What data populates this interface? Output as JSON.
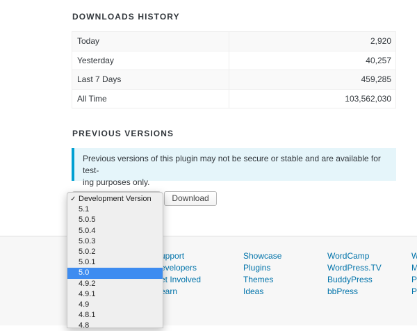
{
  "downloads": {
    "title": "DOWNLOADS HISTORY",
    "rows": [
      {
        "label": "Today",
        "value": "2,920"
      },
      {
        "label": "Yesterday",
        "value": "40,257"
      },
      {
        "label": "Last 7 Days",
        "value": "459,285"
      },
      {
        "label": "All Time",
        "value": "103,562,030"
      }
    ]
  },
  "previous_versions": {
    "title": "PREVIOUS VERSIONS",
    "notice_line1": "Previous versions of this plugin may not be secure or stable and are available for test-",
    "notice_line2": "ing purposes only.",
    "download_label": "Download",
    "checkmark": "✓",
    "options": [
      "Development Version",
      "5.1",
      "5.0.5",
      "5.0.4",
      "5.0.3",
      "5.0.2",
      "5.0.1",
      "5.0",
      "4.9.2",
      "4.9.1",
      "4.9",
      "4.8.1",
      "4.8"
    ],
    "checked_option": "Development Version",
    "highlighted_option": "5.0"
  },
  "footer": {
    "col1": [
      "upport",
      "evelopers",
      "et Involved",
      "earn"
    ],
    "col2": [
      "Showcase",
      "Plugins",
      "Themes",
      "Ideas"
    ],
    "col3": [
      "WordCamp",
      "WordPress.TV",
      "BuddyPress",
      "bbPress"
    ],
    "col4": [
      "W",
      "M",
      "P",
      "P"
    ]
  },
  "colors": {
    "link": "#0073aa",
    "notice_border": "#00a0d2",
    "notice_bg": "#e5f5fa",
    "highlight": "#3e8cf0"
  }
}
